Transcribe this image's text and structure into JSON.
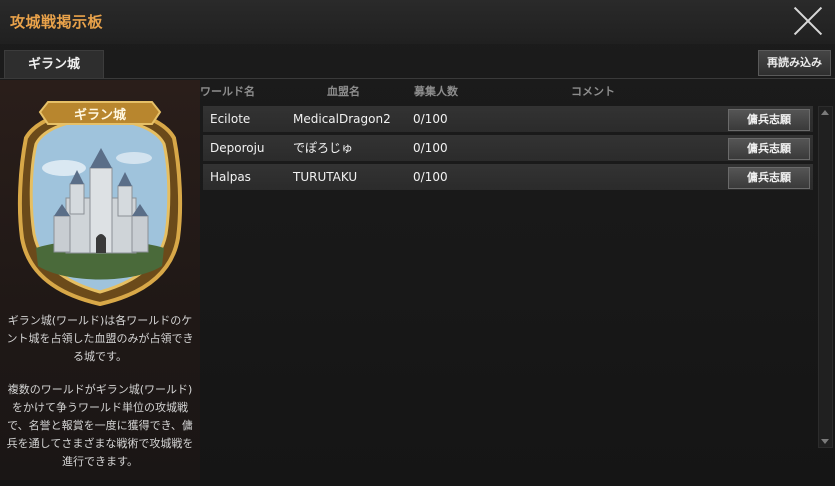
{
  "window": {
    "title": "攻城戦掲示板",
    "close_icon": "close-icon"
  },
  "tabs": [
    {
      "label": "ギラン城",
      "active": true
    }
  ],
  "toolbar": {
    "reload_label": "再読み込み"
  },
  "castle": {
    "banner_label": "ギラン城",
    "description": [
      "ギラン城(ワールド)は各ワールドのケント城を占領した血盟のみが占領できる城です。",
      "複数のワールドがギラン城(ワールド)をかけて争うワールド単位の攻城戦で、名誉と報賞を一度に獲得でき、傭兵を通してさまざまな戦術で攻城戦を進行できます。"
    ]
  },
  "table": {
    "columns": {
      "world": "ワールド名",
      "guild": "血盟名",
      "count": "募集人数",
      "comment": "コメント"
    },
    "rows": [
      {
        "world": "Ecilote",
        "guild": "MedicalDragon2",
        "count": "0/100",
        "comment": "",
        "action": "傭兵志願"
      },
      {
        "world": "Deporoju",
        "guild": "でぽろじゅ",
        "count": "0/100",
        "comment": "",
        "action": "傭兵志願"
      },
      {
        "world": "Halpas",
        "guild": "TURUTAKU",
        "count": "0/100",
        "comment": "",
        "action": "傭兵志願"
      }
    ]
  },
  "colors": {
    "title": "#e9a24a",
    "gold_frame": "#c9973a",
    "banner": "#b8862e"
  }
}
